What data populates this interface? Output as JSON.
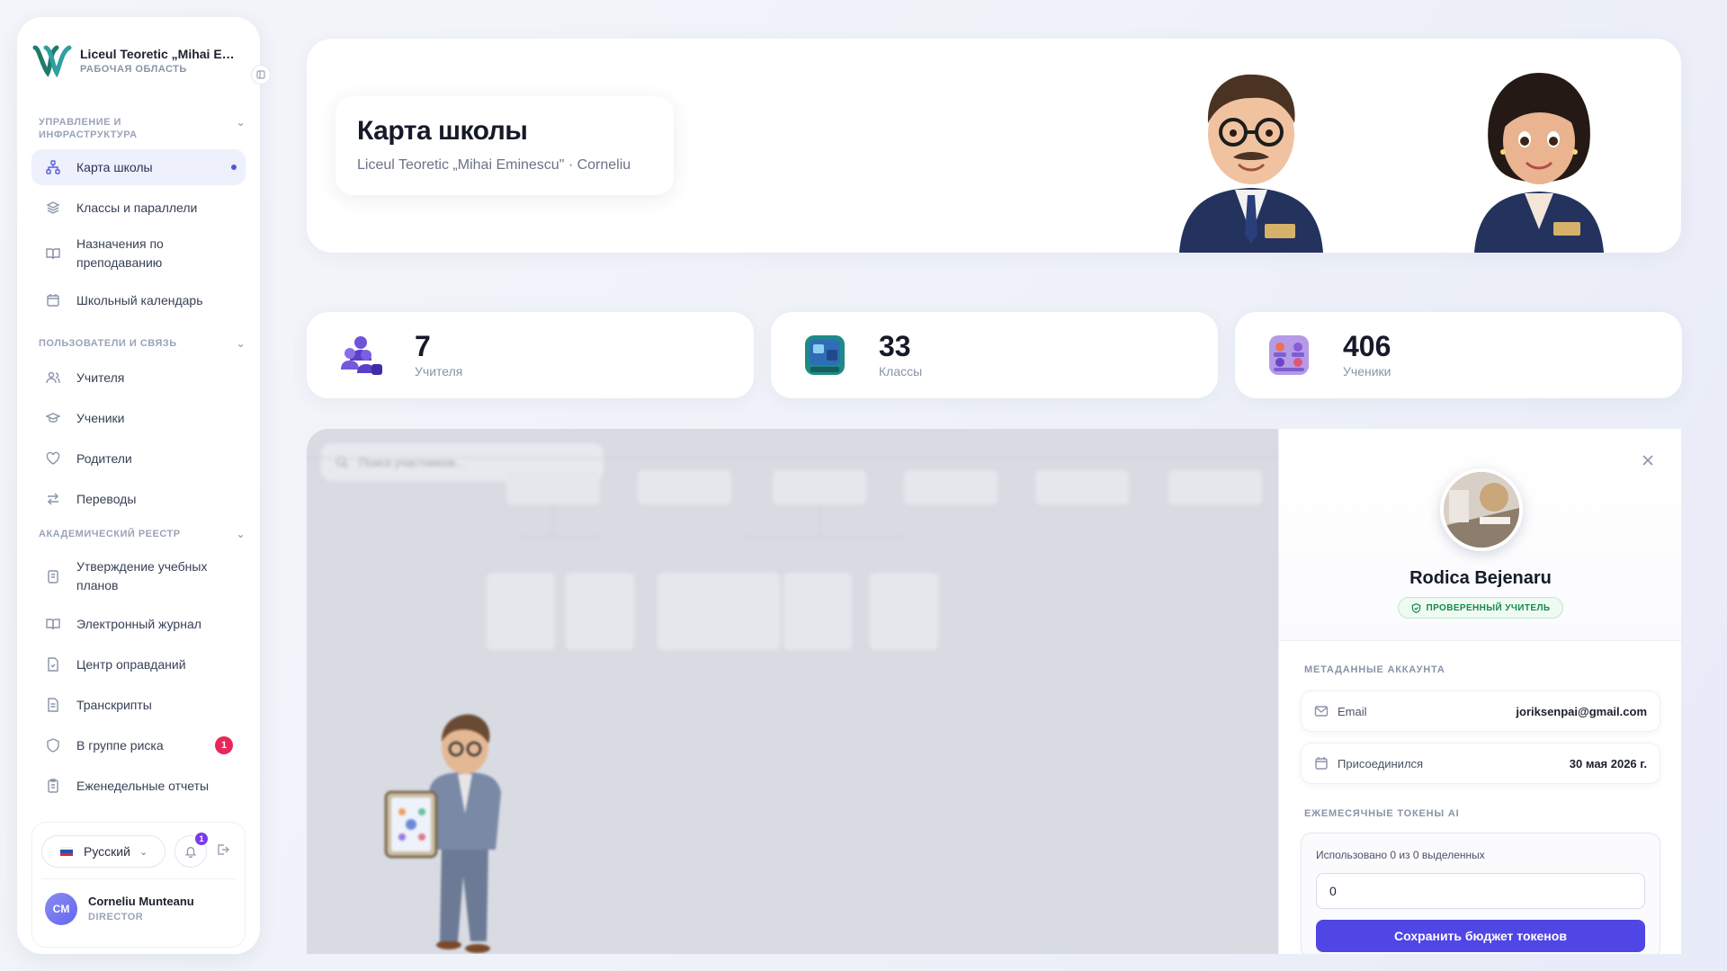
{
  "brand": {
    "name": "Liceul Teoretic „Mihai Emi...",
    "workspace": "РАБОЧАЯ ОБЛАСТЬ"
  },
  "sidebar": {
    "sections": [
      {
        "title": "УПРАВЛЕНИЕ И ИНФРАСТРУКТУРА"
      },
      {
        "title": "ПОЛЬЗОВАТЕЛИ И СВЯЗЬ"
      },
      {
        "title": "АКАДЕМИЧЕСКИЙ РЕЕСТР"
      }
    ],
    "items": [
      {
        "label": "Карта школы",
        "icon": "sitemap-icon"
      },
      {
        "label": "Классы и параллели",
        "icon": "layers-icon"
      },
      {
        "label": "Назначения по преподаванию",
        "icon": "book-open-icon"
      },
      {
        "label": "Школьный календарь",
        "icon": "calendar-icon"
      },
      {
        "label": "Учителя",
        "icon": "users-icon"
      },
      {
        "label": "Ученики",
        "icon": "graduation-cap-icon"
      },
      {
        "label": "Родители",
        "icon": "heart-icon"
      },
      {
        "label": "Переводы",
        "icon": "transfer-arrows-icon"
      },
      {
        "label": "Утверждение учебных планов",
        "icon": "clipboard-icon"
      },
      {
        "label": "Электронный журнал",
        "icon": "book-open-icon"
      },
      {
        "label": "Центр оправданий",
        "icon": "file-check-icon"
      },
      {
        "label": "Транскрипты",
        "icon": "file-text-icon"
      },
      {
        "label": "В группе риска",
        "icon": "shield-icon",
        "badge": "1"
      },
      {
        "label": "Еженедельные отчеты",
        "icon": "clipboard-list-icon"
      }
    ]
  },
  "footer": {
    "language": "Русский",
    "notifications": "1",
    "user": {
      "initials": "CM",
      "name": "Corneliu Munteanu",
      "role": "DIRECTOR"
    }
  },
  "hero": {
    "title": "Карта школы",
    "subtitle": "Liceul Teoretic „Mihai Eminescu\" · Corneliu"
  },
  "stats": [
    {
      "value": "7",
      "label": "Учителя",
      "icon": "teachers-icon"
    },
    {
      "value": "33",
      "label": "Классы",
      "icon": "classroom-icon"
    },
    {
      "value": "406",
      "label": "Ученики",
      "icon": "students-icon"
    }
  ],
  "map": {
    "search_placeholder": "Поиск участников..."
  },
  "profile": {
    "name": "Rodica Bejenaru",
    "verified": "ПРОВЕРЕННЫЙ УЧИТЕЛЬ",
    "meta_title": "МЕТАДАННЫЕ АККАУНТА",
    "email_label": "Email",
    "email_value": "joriksenpai@gmail.com",
    "joined_label": "Присоединился",
    "joined_value": "30 мая 2026 г.",
    "tokens_title": "ЕЖЕМЕСЯЧНЫЕ ТОКЕНЫ AI",
    "tokens_note": "Использовано 0 из 0 выделенных",
    "tokens_value": "0",
    "save_label": "Сохранить бюджет токенов"
  },
  "colors": {
    "accent": "#4f46e5",
    "danger": "#e8285a",
    "verified": "#168a4a"
  }
}
